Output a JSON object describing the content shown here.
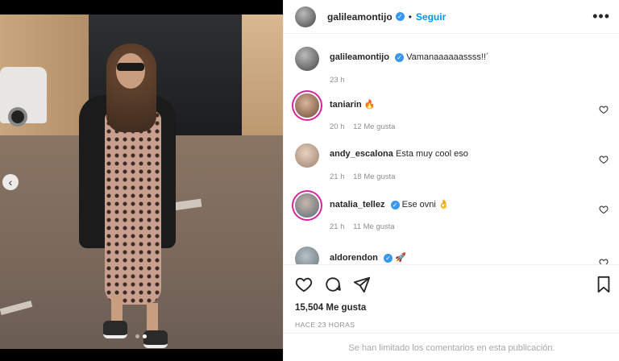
{
  "post": {
    "username": "galileamontijo",
    "separator": "•",
    "follow_label": "Seguir",
    "more_label": "•••",
    "caption": {
      "username": "galileamontijo",
      "text": "Vamanaaaaaassss!!´",
      "time": "23 h"
    }
  },
  "comments": [
    {
      "username": "taniarin",
      "text": "🔥",
      "time": "20 h",
      "likes": "12 Me gusta",
      "verified": false
    },
    {
      "username": "andy_escalona",
      "text": "Esta muy cool eso",
      "time": "21 h",
      "likes": "18 Me gusta",
      "verified": false
    },
    {
      "username": "natalia_tellez",
      "text": "Ese ovni 👌",
      "time": "21 h",
      "likes": "11 Me gusta",
      "verified": true
    },
    {
      "username": "aldorendon",
      "text": "🚀",
      "time": "",
      "likes": "",
      "verified": true
    }
  ],
  "actions": {
    "likes_count": "15,504 Me gusta",
    "post_time": "HACE 23 HORAS",
    "comments_limited": "Se han limitado los comentarios en esta publicación."
  },
  "carousel": {
    "prev_icon": "‹",
    "total": 2,
    "current": 2
  },
  "colors": {
    "accent": "#0095f6",
    "verified": "#3897f0",
    "muted": "#8e8e8e"
  }
}
